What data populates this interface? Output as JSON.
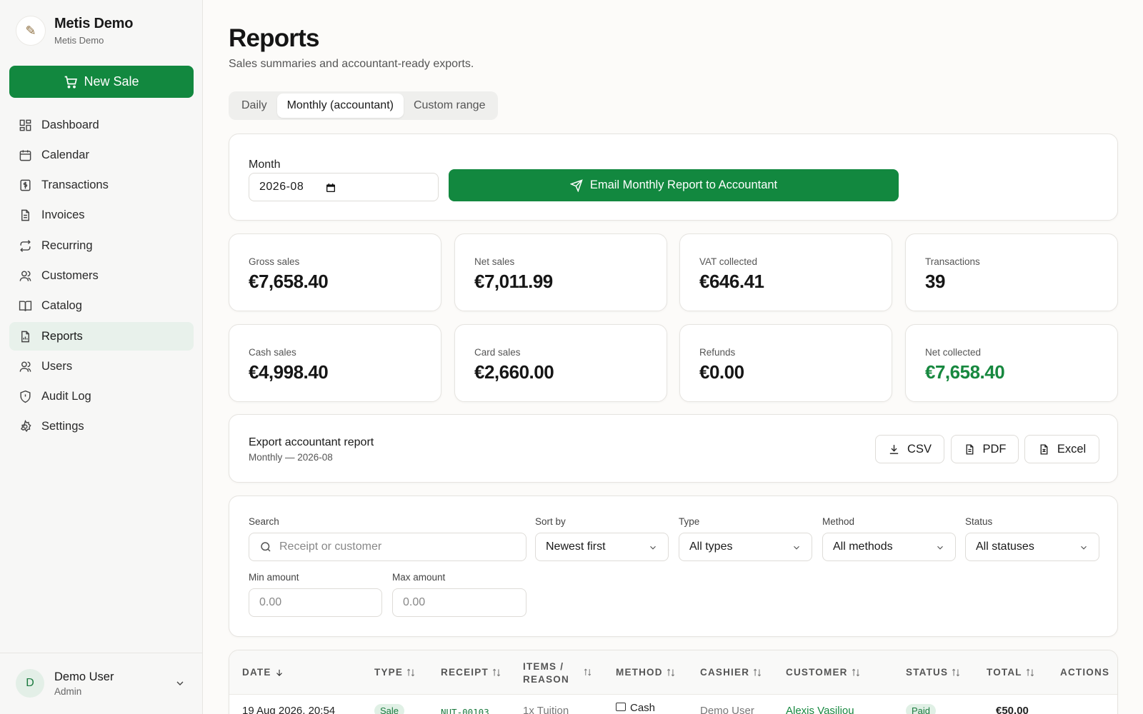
{
  "brand": {
    "name": "Metis Demo",
    "sub": "Metis Demo"
  },
  "new_sale_label": "New Sale",
  "nav": [
    {
      "label": "Dashboard",
      "icon": "dashboard-icon"
    },
    {
      "label": "Calendar",
      "icon": "calendar-icon"
    },
    {
      "label": "Transactions",
      "icon": "receipt-icon"
    },
    {
      "label": "Invoices",
      "icon": "document-icon"
    },
    {
      "label": "Recurring",
      "icon": "repeat-icon"
    },
    {
      "label": "Customers",
      "icon": "users-icon"
    },
    {
      "label": "Catalog",
      "icon": "book-icon"
    },
    {
      "label": "Reports",
      "icon": "report-icon",
      "active": true
    },
    {
      "label": "Users",
      "icon": "users-icon"
    },
    {
      "label": "Audit Log",
      "icon": "shield-icon"
    },
    {
      "label": "Settings",
      "icon": "gear-icon"
    }
  ],
  "user": {
    "initial": "D",
    "name": "Demo User",
    "role": "Admin"
  },
  "page": {
    "title": "Reports",
    "subtitle": "Sales summaries and accountant-ready exports."
  },
  "tabs": [
    "Daily",
    "Monthly (accountant)",
    "Custom range"
  ],
  "month": {
    "label": "Month",
    "value": "2026-08",
    "email_label": "Email Monthly Report to Accountant"
  },
  "stats": [
    {
      "label": "Gross sales",
      "value": "€7,658.40"
    },
    {
      "label": "Net sales",
      "value": "€7,011.99"
    },
    {
      "label": "VAT collected",
      "value": "€646.41"
    },
    {
      "label": "Transactions",
      "value": "39"
    },
    {
      "label": "Cash sales",
      "value": "€4,998.40"
    },
    {
      "label": "Card sales",
      "value": "€2,660.00"
    },
    {
      "label": "Refunds",
      "value": "€0.00"
    },
    {
      "label": "Net collected",
      "value": "€7,658.40"
    }
  ],
  "colors": {
    "accent": "#12883f",
    "positive": "#17883f"
  },
  "export": {
    "title": "Export accountant report",
    "sub": "Monthly — 2026-08",
    "csv": "CSV",
    "pdf": "PDF",
    "excel": "Excel"
  },
  "filters": {
    "search_label": "Search",
    "search_placeholder": "Receipt or customer",
    "sort_label": "Sort by",
    "sort_value": "Newest first",
    "type_label": "Type",
    "type_value": "All types",
    "method_label": "Method",
    "method_value": "All methods",
    "status_label": "Status",
    "status_value": "All statuses",
    "min_label": "Min amount",
    "min_placeholder": "0.00",
    "max_label": "Max amount",
    "max_placeholder": "0.00"
  },
  "table": {
    "headers": {
      "date": "DATE",
      "type": "TYPE",
      "receipt": "RECEIPT",
      "items1": "ITEMS /",
      "items2": "REASON",
      "method": "METHOD",
      "cashier": "CASHIER",
      "customer": "CUSTOMER",
      "status": "STATUS",
      "total": "TOTAL",
      "actions": "ACTIONS"
    },
    "row": {
      "date": "19 Aug 2026, 20:54",
      "type": "Sale",
      "receipt": "NUT-00103",
      "items": "1x Tuition",
      "method": "Cash",
      "cashier": "Demo User",
      "customer": "Alexis Vasiliou",
      "status": "Paid",
      "total": "€50.00"
    }
  }
}
